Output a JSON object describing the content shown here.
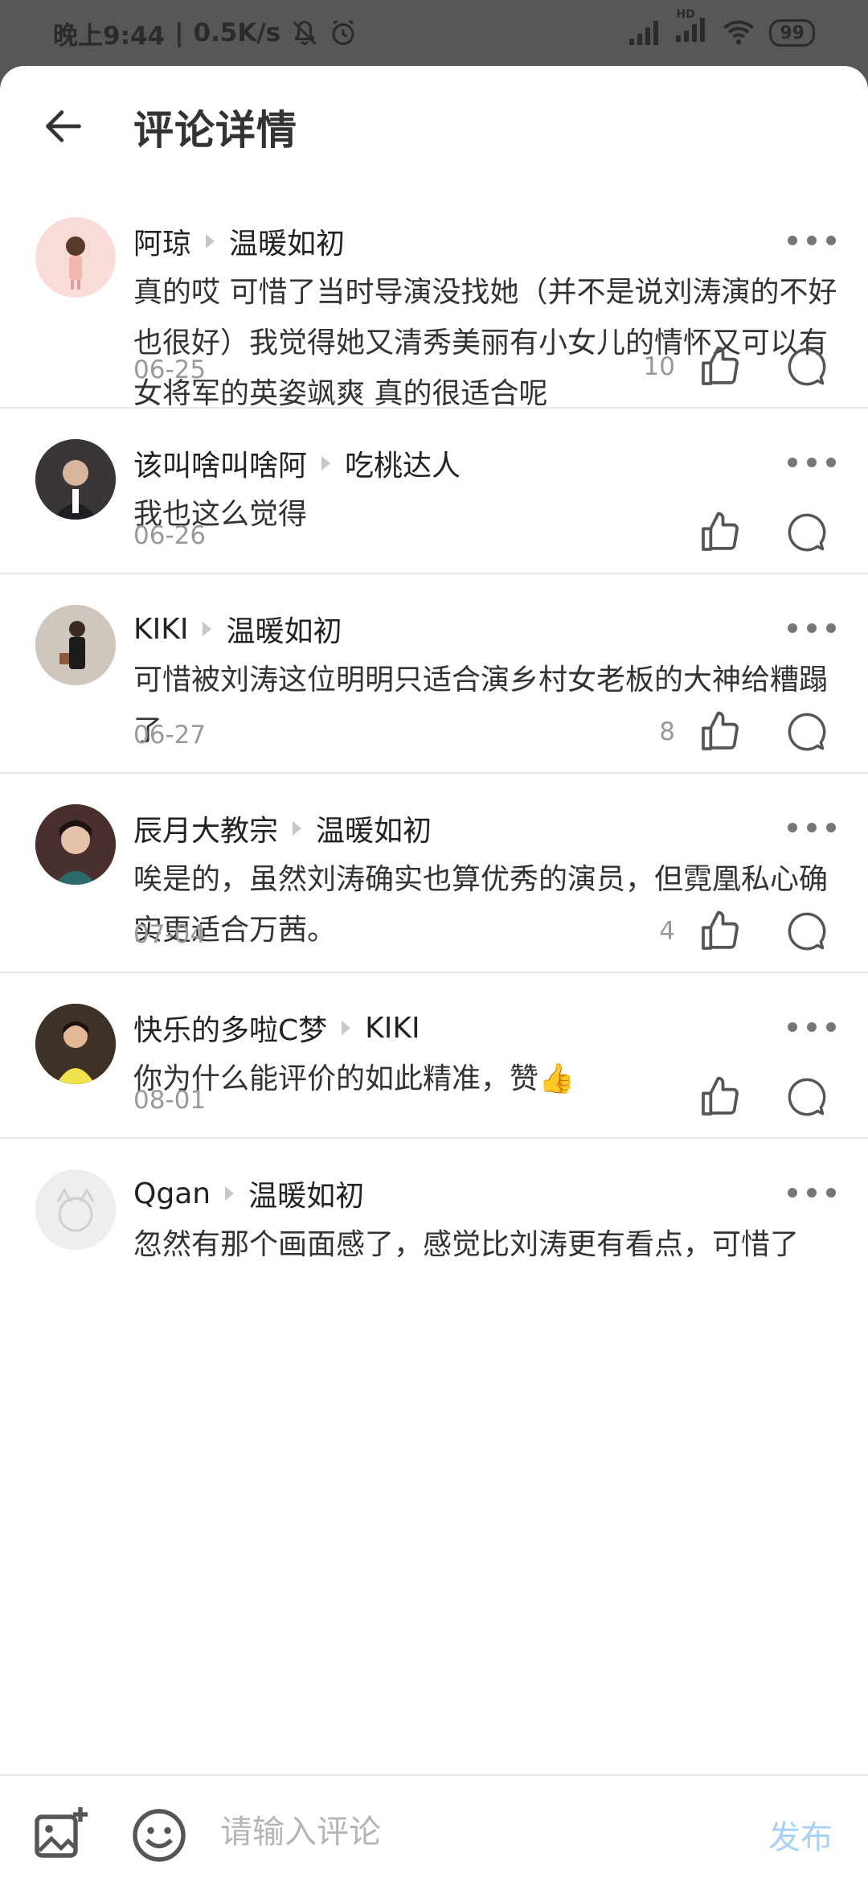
{
  "status": {
    "time": "晚上9:44",
    "speed": "0.5K/s",
    "hd": "HD",
    "battery": "99"
  },
  "header": {
    "title": "评论详情"
  },
  "comments": [
    {
      "user": "阿琼",
      "reply_to": "温暖如初",
      "text": "真的哎 可惜了当时导演没找她（并不是说刘涛演的不好 也很好）我觉得她又清秀美丽有小女儿的情怀又可以有女将军的英姿飒爽 真的很适合呢",
      "date": "06-25",
      "likes": "10"
    },
    {
      "user": "该叫啥叫啥阿",
      "reply_to": "吃桃达人",
      "text": "我也这么觉得",
      "date": "06-26",
      "likes": ""
    },
    {
      "user": "KIKI",
      "reply_to": "温暖如初",
      "text": "可惜被刘涛这位明明只适合演乡村女老板的大神给糟蹋了",
      "date": "06-27",
      "likes": "8"
    },
    {
      "user": "辰月大教宗",
      "reply_to": "温暖如初",
      "text": "唉是的，虽然刘涛确实也算优秀的演员，但霓凰私心确实更适合万茜。",
      "date": "07-04",
      "likes": "4"
    },
    {
      "user": "快乐的多啦C梦",
      "reply_to": "KIKI",
      "text": "你为什么能评价的如此精准，赞👍",
      "date": "08-01",
      "likes": ""
    },
    {
      "user": "Qgan",
      "reply_to": "温暖如初",
      "text": "忽然有那个画面感了，感觉比刘涛更有看点，可惜了",
      "date": "",
      "likes": ""
    }
  ],
  "bottom_bar": {
    "placeholder": "请输入评论",
    "publish": "发布"
  },
  "colors": {
    "accent": "#a9d1f3",
    "text": "#333333",
    "meta": "#999999"
  }
}
